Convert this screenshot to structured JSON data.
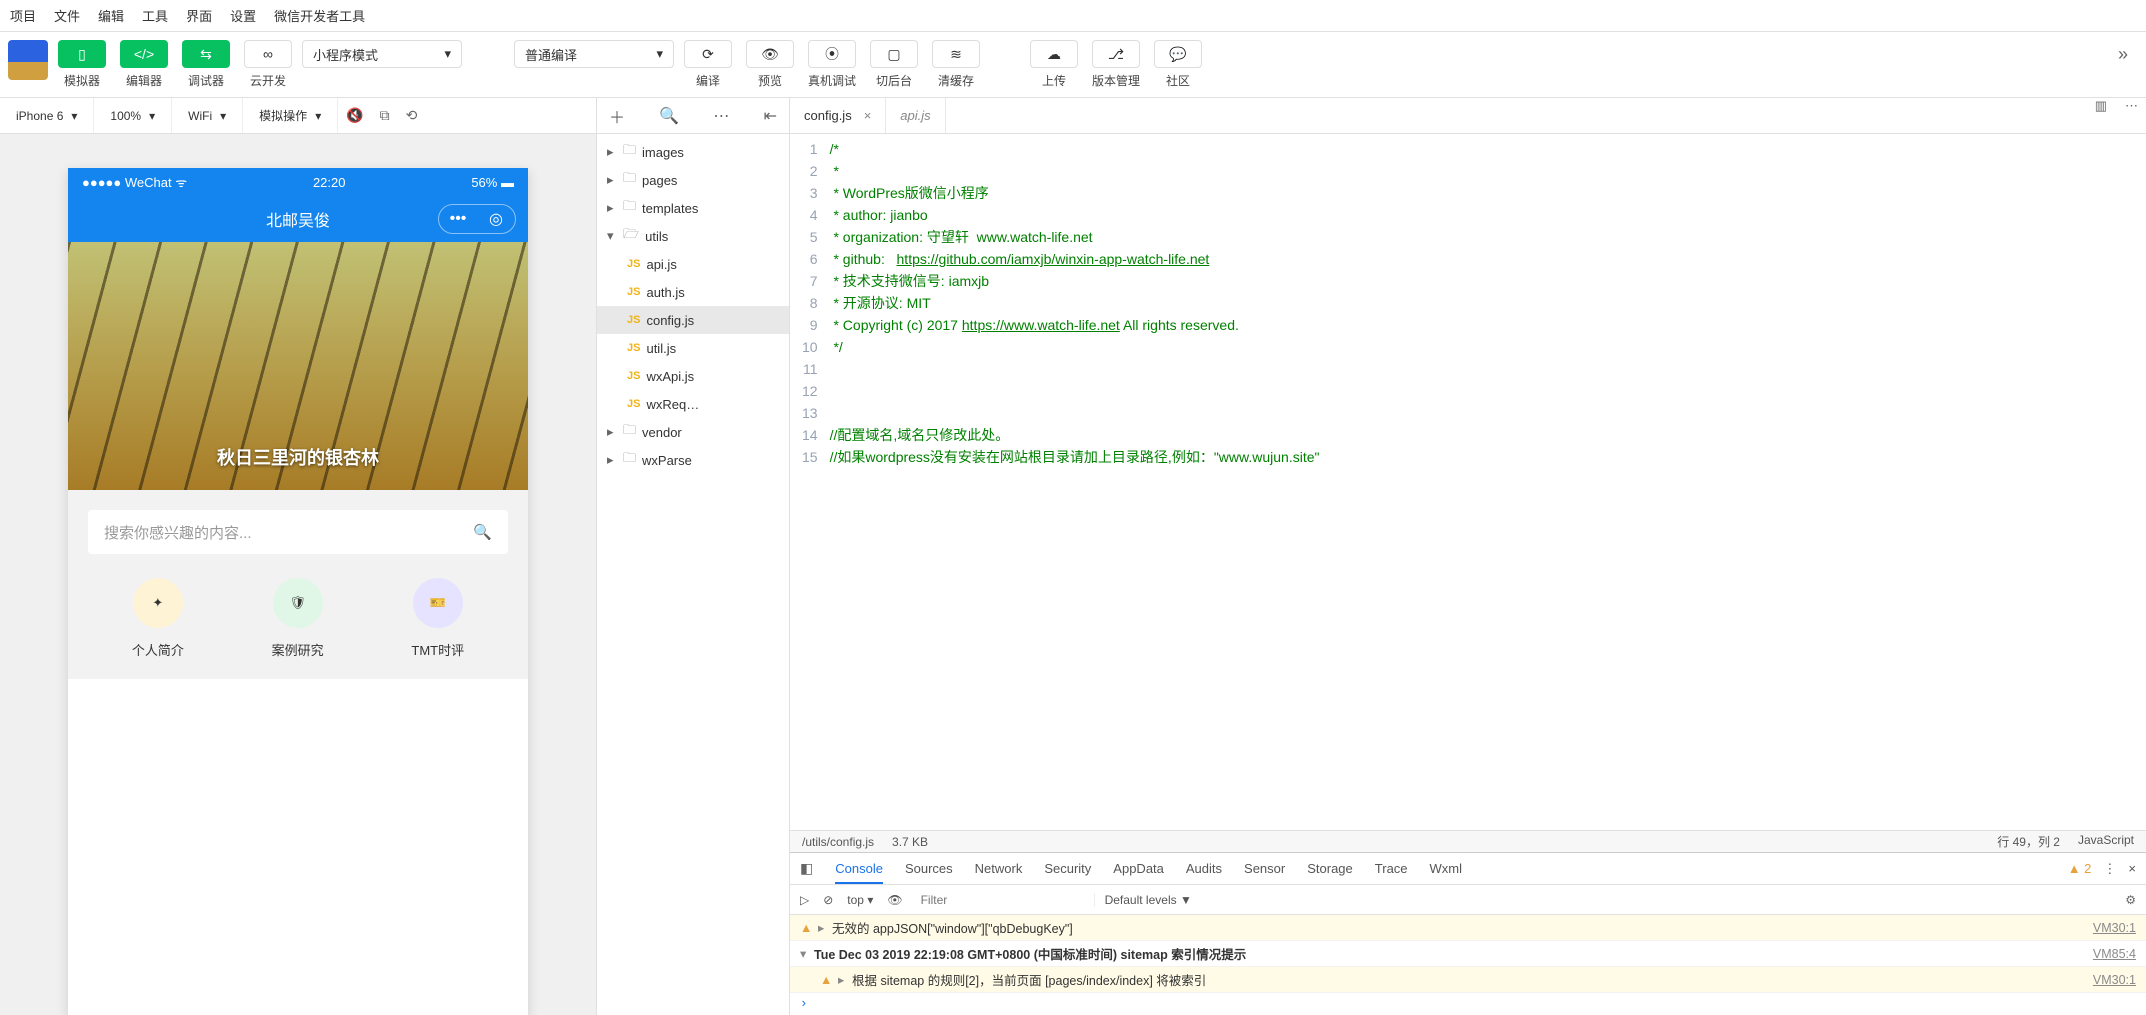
{
  "menu": [
    "项目",
    "文件",
    "编辑",
    "工具",
    "界面",
    "设置",
    "微信开发者工具"
  ],
  "toolbarGreen": [
    {
      "icon": "phone",
      "label": "模拟器"
    },
    {
      "icon": "code",
      "label": "编辑器"
    },
    {
      "icon": "debug",
      "label": "调试器"
    }
  ],
  "cloud": {
    "label": "云开发"
  },
  "mode": "小程序模式",
  "compile": "普通编译",
  "right": [
    {
      "label": "编译"
    },
    {
      "label": "预览"
    },
    {
      "label": "真机调试"
    },
    {
      "label": "切后台"
    },
    {
      "label": "清缓存"
    },
    {
      "label": "上传"
    },
    {
      "label": "版本管理"
    },
    {
      "label": "社区"
    }
  ],
  "simbar": {
    "device": "iPhone 6",
    "zoom": "100%",
    "net": "WiFi",
    "act": "模拟操作"
  },
  "phone": {
    "carrier": "WeChat",
    "time": "22:20",
    "battery": "56%",
    "title": "北邮吴俊",
    "cover": "秋日三里河的银杏林",
    "searchPh": "搜索你感兴趣的内容...",
    "cats": [
      {
        "label": "个人简介"
      },
      {
        "label": "案例研究"
      },
      {
        "label": "TMT时评"
      }
    ]
  },
  "tree": {
    "folders": [
      "images",
      "pages",
      "templates"
    ],
    "utils": [
      "api.js",
      "auth.js",
      "config.js",
      "util.js",
      "wxApi.js",
      "wxReq…"
    ],
    "tail": [
      "vendor",
      "wxParse"
    ]
  },
  "tabs": [
    {
      "name": "config.js",
      "active": true
    },
    {
      "name": "api.js",
      "active": false
    }
  ],
  "code": {
    "l1": "/*",
    "l2": " *",
    "l3": " * WordPres版微信小程序",
    "l4": " * author: jianbo",
    "l5": " * organization: 守望轩  www.watch-life.net",
    "l6a": " * github:   ",
    "l6b": "https://github.com/iamxjb/winxin-app-watch-life.net",
    "l7": " * 技术支持微信号: iamxjb",
    "l8": " * 开源协议: MIT",
    "l9a": " * Copyright (c) 2017 ",
    "l9b": "https://www.watch-life.net",
    "l9c": " All rights reserved.",
    "l10": " */",
    "l14": "//配置域名,域名只修改此处。",
    "l15": "//如果wordpress没有安装在网站根目录请加上目录路径,例如：\"www.wujun.site\""
  },
  "status": {
    "path": "/utils/config.js",
    "size": "3.7 KB",
    "pos": "行 49，列 2",
    "lang": "JavaScript"
  },
  "dev": {
    "tabs": [
      "Console",
      "Sources",
      "Network",
      "Security",
      "AppData",
      "Audits",
      "Sensor",
      "Storage",
      "Trace",
      "Wxml"
    ],
    "warnCount": "2",
    "scope": "top",
    "filterPh": "Filter",
    "levels": "Default levels ▼",
    "r1": "无效的 appJSON[\"window\"][\"qbDebugKey\"]",
    "r1s": "VM30:1",
    "r2": "Tue Dec 03 2019 22:19:08 GMT+0800 (中国标准时间) sitemap 索引情况提示",
    "r2s": "VM85:4",
    "r3": "根据 sitemap 的规则[2]，当前页面 [pages/index/index] 将被索引",
    "r3s": "VM30:1"
  }
}
